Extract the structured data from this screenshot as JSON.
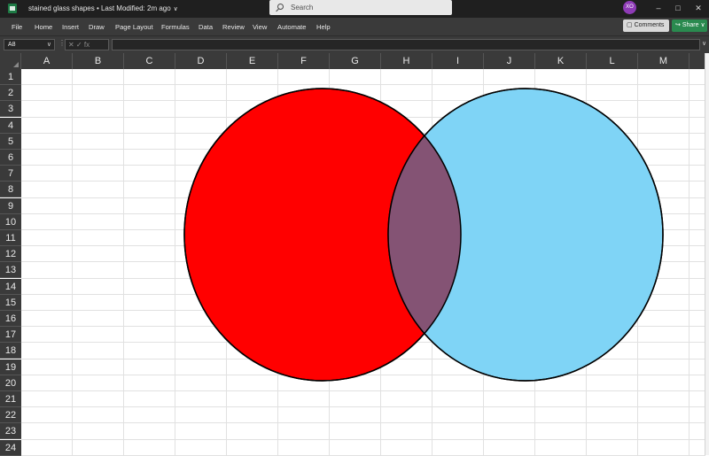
{
  "title_bar": {
    "doc_title": "stained glass shapes • Last Modified: 2m ago",
    "search_placeholder": "Search",
    "avatar_initials": "XO",
    "minimize": "–",
    "maximize": "□",
    "close": "✕"
  },
  "ribbon": {
    "tabs": [
      "File",
      "Home",
      "Insert",
      "Draw",
      "Page Layout",
      "Formulas",
      "Data",
      "Review",
      "View",
      "Automate",
      "Help"
    ],
    "comments_label": "Comments",
    "share_label": "Share"
  },
  "formula_bar": {
    "name_box": "A8",
    "fx_icons": "✕ ✓ fx"
  },
  "grid": {
    "columns": [
      "A",
      "B",
      "C",
      "D",
      "E",
      "F",
      "G",
      "H",
      "I",
      "J",
      "K",
      "L",
      "M"
    ],
    "rows": [
      "1",
      "2",
      "3",
      "4",
      "5",
      "6",
      "7",
      "8",
      "9",
      "10",
      "11",
      "12",
      "13",
      "14",
      "15",
      "16",
      "17",
      "18",
      "19",
      "20",
      "21",
      "22",
      "23",
      "24"
    ]
  },
  "shapes": {
    "left_circle_color": "#ff0000",
    "right_circle_color": "#7fd4f6",
    "overlap_color": "#845374",
    "outline_color": "#000000"
  },
  "icons": [
    "excel-app-icon",
    "search-icon",
    "chevron-down-icon",
    "comments-icon",
    "share-icon"
  ]
}
